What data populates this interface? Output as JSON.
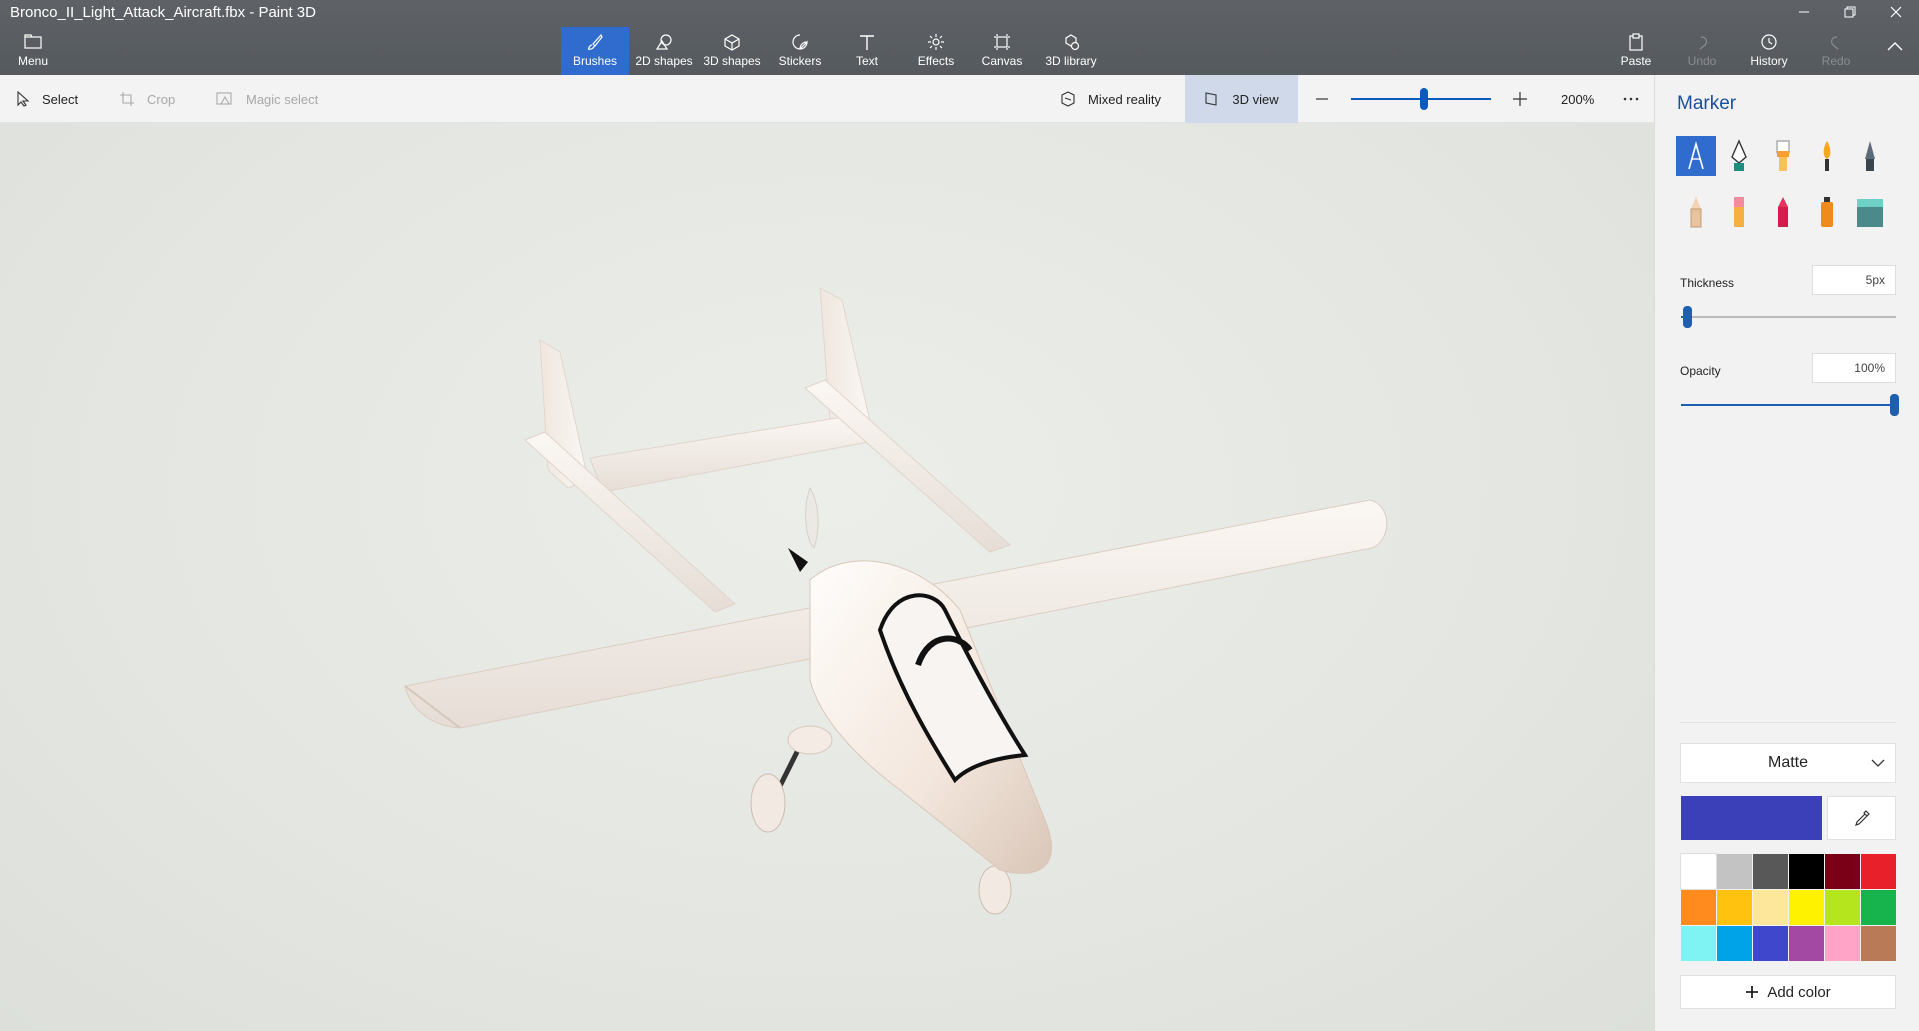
{
  "window": {
    "title": "Bronco_II_Light_Attack_Aircraft.fbx - Paint 3D"
  },
  "ribbon": {
    "menu": "Menu",
    "tabs": [
      {
        "label": "Brushes",
        "icon": "brush-icon",
        "active": true
      },
      {
        "label": "2D shapes",
        "icon": "2d-shapes-icon"
      },
      {
        "label": "3D shapes",
        "icon": "3d-shapes-icon"
      },
      {
        "label": "Stickers",
        "icon": "stickers-icon"
      },
      {
        "label": "Text",
        "icon": "text-icon"
      },
      {
        "label": "Effects",
        "icon": "effects-icon"
      },
      {
        "label": "Canvas",
        "icon": "canvas-icon"
      },
      {
        "label": "3D library",
        "icon": "3d-library-icon"
      }
    ],
    "paste": "Paste",
    "undo": "Undo",
    "history": "History",
    "redo": "Redo"
  },
  "toolbar": {
    "select": "Select",
    "crop": "Crop",
    "magic_select": "Magic select",
    "mixed_reality": "Mixed reality",
    "view3d": "3D view",
    "zoom": "200%",
    "zoom_level": 0.55
  },
  "panel": {
    "title": "Marker",
    "brushes": [
      "marker",
      "calligraphy-pen",
      "oil-brush",
      "watercolor",
      "pixel-pen",
      "pencil",
      "eraser",
      "crayon",
      "spray-can",
      "fill"
    ],
    "thickness_label": "Thickness",
    "thickness_value": "5px",
    "thickness_level": 0.05,
    "opacity_label": "Opacity",
    "opacity_value": "100%",
    "opacity_level": 1.0,
    "finish": "Matte",
    "current_color": "#3b3fb8",
    "palette": [
      "#ffffff",
      "#c3c3c3",
      "#585858",
      "#000000",
      "#7a0018",
      "#e8202a",
      "#ff8a1e",
      "#ffc20e",
      "#fde79a",
      "#fff200",
      "#b5e61d",
      "#17b34c",
      "#7ff3f3",
      "#00a2e8",
      "#3f48cc",
      "#a349a4",
      "#ffa3c7",
      "#b97a57"
    ],
    "add_color": "Add color"
  }
}
